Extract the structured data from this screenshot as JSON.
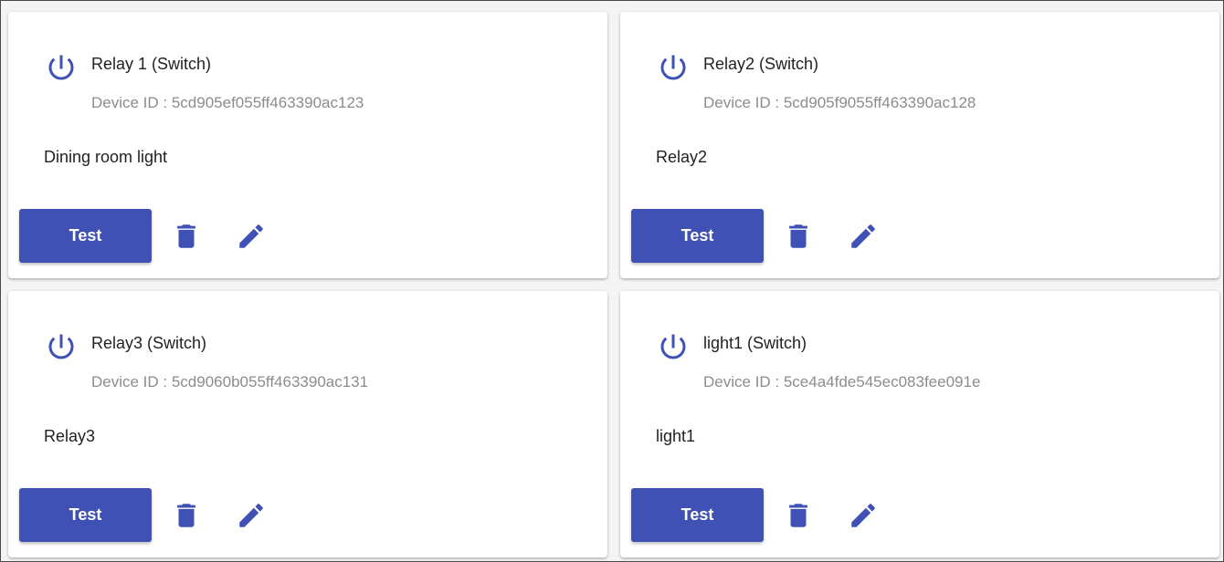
{
  "accent_color": "#3f51b5",
  "devices": [
    {
      "title": "Relay 1 (Switch)",
      "device_id": "Device ID : 5cd905ef055ff463390ac123",
      "description": "Dining room light",
      "test_label": "Test",
      "icons": [
        "power-icon",
        "delete-icon",
        "edit-icon"
      ]
    },
    {
      "title": "Relay2 (Switch)",
      "device_id": "Device ID : 5cd905f9055ff463390ac128",
      "description": "Relay2",
      "test_label": "Test",
      "icons": [
        "power-icon",
        "delete-icon",
        "edit-icon"
      ]
    },
    {
      "title": "Relay3 (Switch)",
      "device_id": "Device ID : 5cd9060b055ff463390ac131",
      "description": "Relay3",
      "test_label": "Test",
      "icons": [
        "power-icon",
        "delete-icon",
        "edit-icon"
      ]
    },
    {
      "title": "light1 (Switch)",
      "device_id": "Device ID : 5ce4a4fde545ec083fee091e",
      "description": "light1",
      "test_label": "Test",
      "icons": [
        "power-icon",
        "delete-icon",
        "edit-icon"
      ]
    }
  ]
}
